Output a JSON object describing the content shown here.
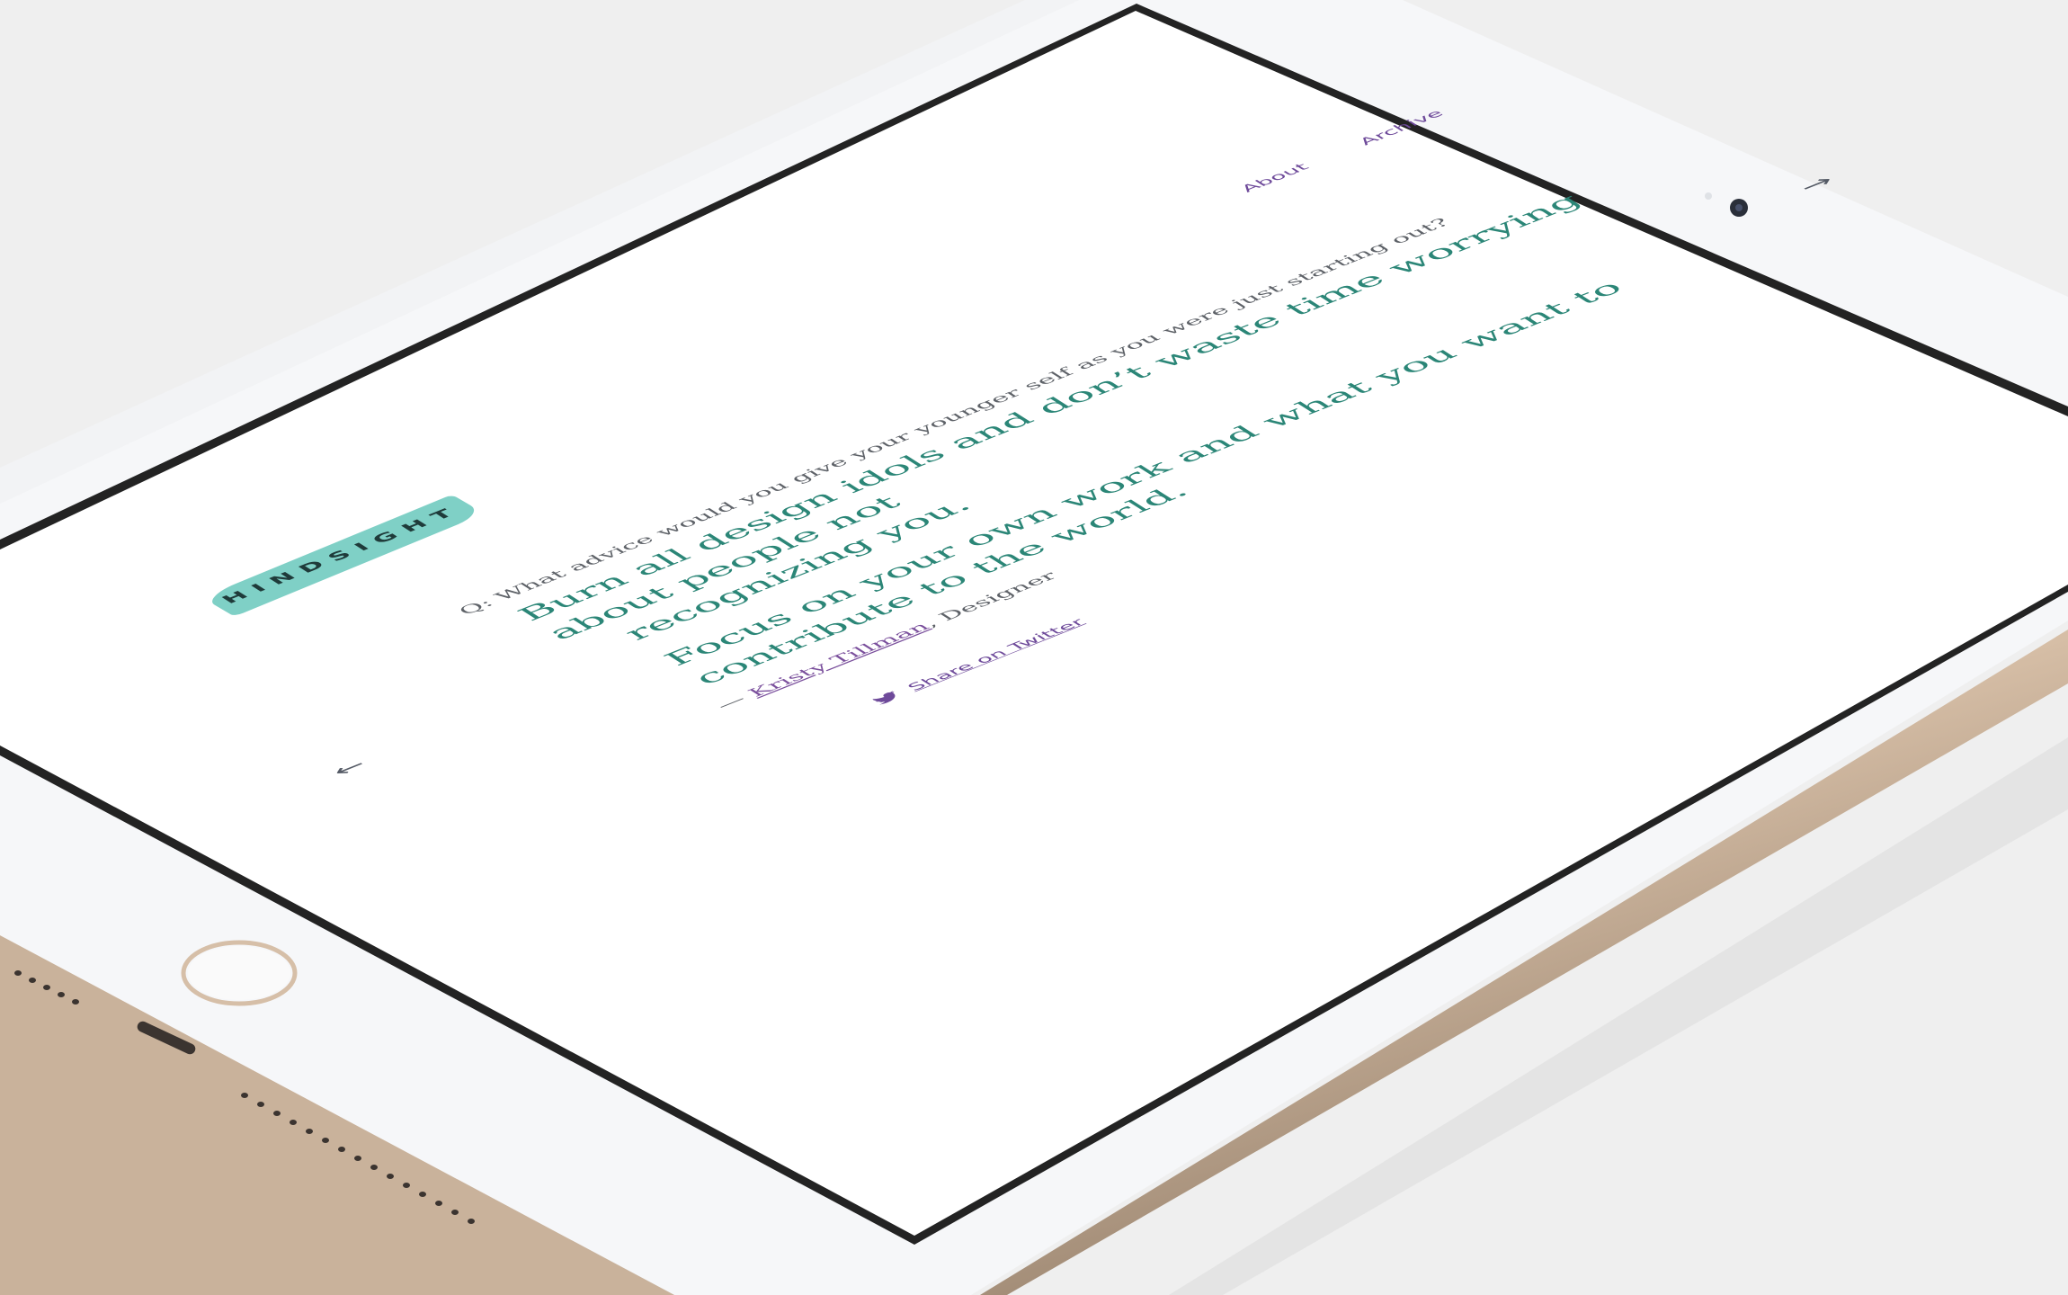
{
  "brand": {
    "logo_text": "HINDSIGHT"
  },
  "nav": {
    "items": [
      {
        "label": "About"
      },
      {
        "label": "Archive"
      }
    ],
    "prev_arrow": "←",
    "next_arrow": "→"
  },
  "post": {
    "question": "Q: What advice would you give your younger self as you were just starting out?",
    "answer_lines": [
      "Burn all design idols and don’t waste time worrying about people not",
      "recognizing you.",
      "Focus on your own work and what you want to contribute to the world."
    ],
    "attribution_dash": "— ",
    "author_name": "Kristy Tillman",
    "author_role": ", Designer",
    "share_label": "Share on Twitter"
  },
  "colors": {
    "accent_green": "#2b8677",
    "accent_purple": "#6e4a9a",
    "logo_brush": "#7fd0c6",
    "device_gold": "#d9c2ab",
    "bezel": "#f6f7f9"
  },
  "icons": {
    "share_icon": "twitter-bird-icon",
    "home_button": "home-button"
  }
}
